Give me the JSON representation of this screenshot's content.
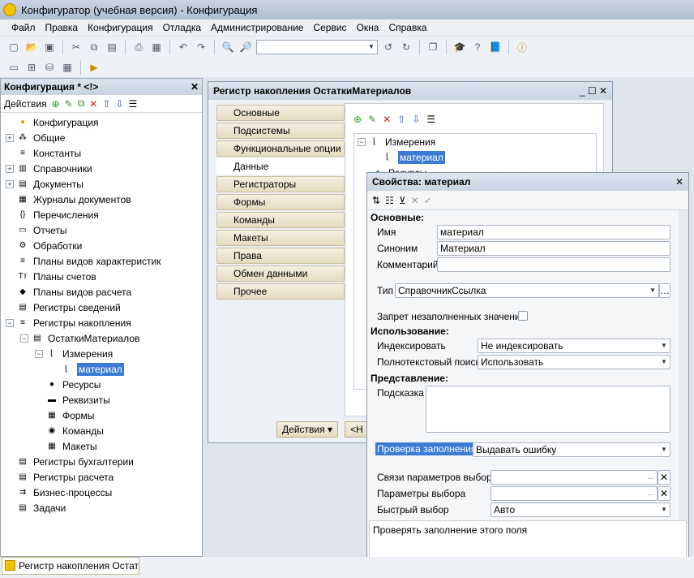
{
  "window_title": "Конфигуратор (учебная версия) - Конфигурация",
  "menu": [
    "Файл",
    "Правка",
    "Конфигурация",
    "Отладка",
    "Администрирование",
    "Сервис",
    "Окна",
    "Справка"
  ],
  "left_panel": {
    "title": "Конфигурация * <!>",
    "actions": "Действия",
    "tree": [
      {
        "label": "Конфигурация",
        "level": 0,
        "exp": ""
      },
      {
        "label": "Общие",
        "level": 0,
        "exp": "+"
      },
      {
        "label": "Константы",
        "level": 0,
        "exp": ""
      },
      {
        "label": "Справочники",
        "level": 0,
        "exp": "+"
      },
      {
        "label": "Документы",
        "level": 0,
        "exp": "+"
      },
      {
        "label": "Журналы документов",
        "level": 0,
        "exp": ""
      },
      {
        "label": "Перечисления",
        "level": 0,
        "exp": ""
      },
      {
        "label": "Отчеты",
        "level": 0,
        "exp": ""
      },
      {
        "label": "Обработки",
        "level": 0,
        "exp": ""
      },
      {
        "label": "Планы видов характеристик",
        "level": 0,
        "exp": ""
      },
      {
        "label": "Планы счетов",
        "level": 0,
        "exp": ""
      },
      {
        "label": "Планы видов расчета",
        "level": 0,
        "exp": ""
      },
      {
        "label": "Регистры сведений",
        "level": 0,
        "exp": ""
      },
      {
        "label": "Регистры накопления",
        "level": 0,
        "exp": "−"
      },
      {
        "label": "ОстаткиМатериалов",
        "level": 1,
        "exp": "−"
      },
      {
        "label": "Измерения",
        "level": 2,
        "exp": "−"
      },
      {
        "label": "материал",
        "level": 3,
        "exp": "",
        "selected": true
      },
      {
        "label": "Ресурсы",
        "level": 2,
        "exp": ""
      },
      {
        "label": "Реквизиты",
        "level": 2,
        "exp": ""
      },
      {
        "label": "Формы",
        "level": 2,
        "exp": ""
      },
      {
        "label": "Команды",
        "level": 2,
        "exp": ""
      },
      {
        "label": "Макеты",
        "level": 2,
        "exp": ""
      },
      {
        "label": "Регистры бухгалтерии",
        "level": 0,
        "exp": ""
      },
      {
        "label": "Регистры расчета",
        "level": 0,
        "exp": ""
      },
      {
        "label": "Бизнес-процессы",
        "level": 0,
        "exp": ""
      },
      {
        "label": "Задачи",
        "level": 0,
        "exp": ""
      }
    ]
  },
  "main_window": {
    "title": "Регистр накопления ОстаткиМатериалов",
    "tabs": [
      "Основные",
      "Подсистемы",
      "Функциональные опции",
      "Данные",
      "Регистраторы",
      "Формы",
      "Команды",
      "Макеты",
      "Права",
      "Обмен данными",
      "Прочее"
    ],
    "active_tab": "Данные",
    "tree_dimensions": "Измерения",
    "tree_item": "материал",
    "tree_resources": "Ресурсы",
    "actions_button": "Действия",
    "back_button": "<Н"
  },
  "properties": {
    "title": "Свойства: материал",
    "sections": {
      "main": "Основные:",
      "usage": "Использование:",
      "presentation": "Представление:"
    },
    "name_label": "Имя",
    "name_value": "материал",
    "synonym_label": "Синоним",
    "synonym_value": "Материал",
    "comment_label": "Комментарий",
    "comment_value": "",
    "type_label": "Тип",
    "type_value": "СправочникСсылка",
    "deny_empty_label": "Запрет незаполненных значений",
    "indexing_label": "Индексировать",
    "indexing_value": "Не индексировать",
    "fulltext_label": "Полнотекстовый поиск",
    "fulltext_value": "Использовать",
    "tooltip_label": "Подсказка",
    "fill_check_label": "Проверка заполнения",
    "fill_check_value": "Выдавать ошибку",
    "links_label": "Связи параметров выбора",
    "params_label": "Параметры выбора",
    "quick_label": "Быстрый выбор",
    "quick_value": "Авто",
    "description": "Проверять заполнение этого поля"
  },
  "taskbar_item": "Регистр накопления Остат..."
}
